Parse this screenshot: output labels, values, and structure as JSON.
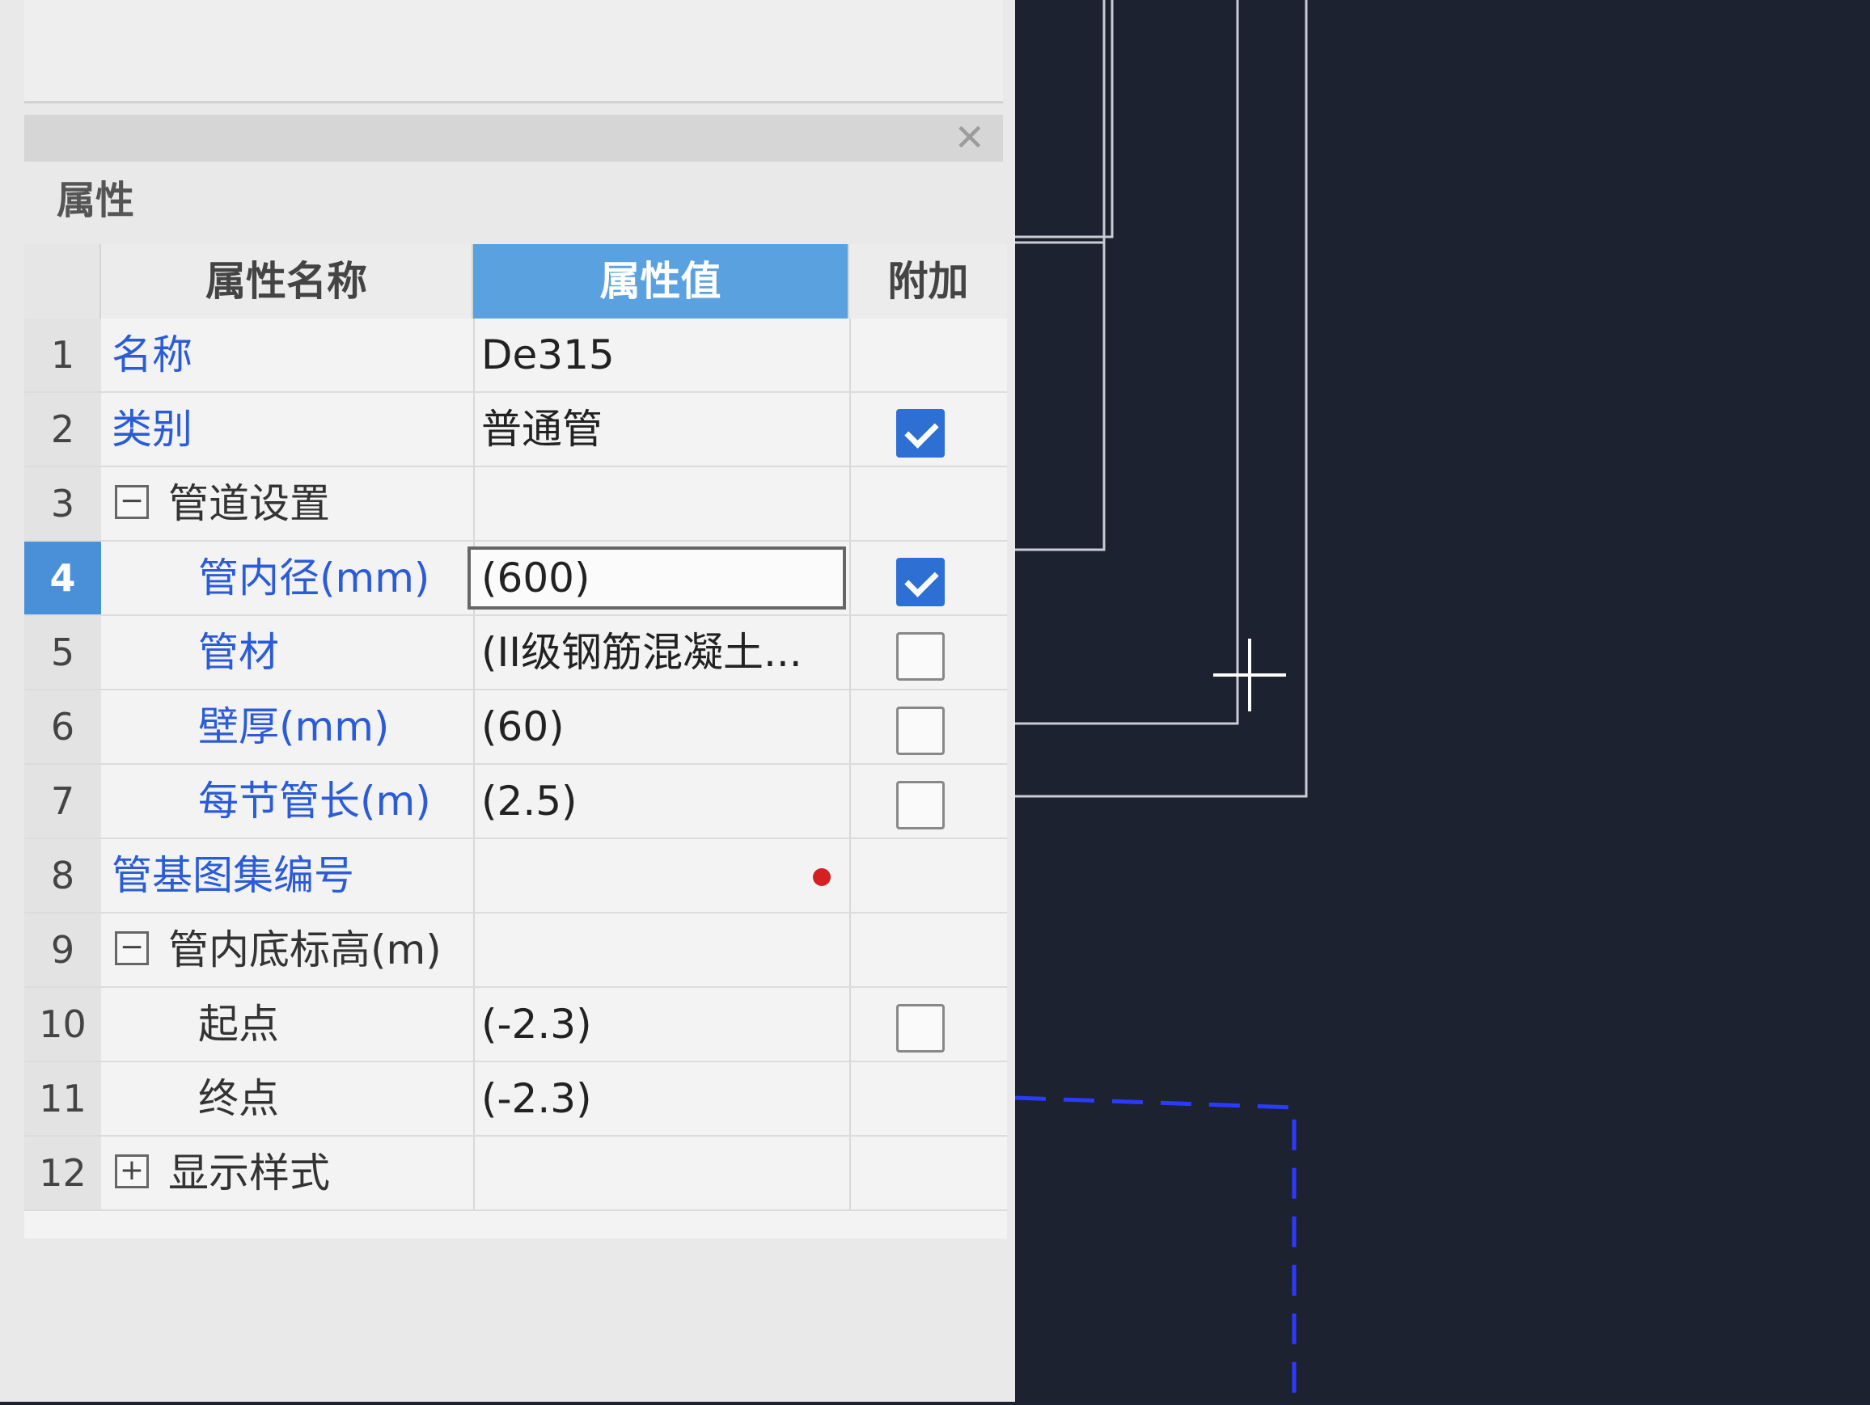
{
  "panel": {
    "title": "属性",
    "headers": {
      "name": "属性名称",
      "value": "属性值",
      "extra": "附加"
    },
    "rows": [
      {
        "idx": "1",
        "name": "名称",
        "value": "De315",
        "check": null,
        "toggle": null,
        "level": 0,
        "color": "blue"
      },
      {
        "idx": "2",
        "name": "类别",
        "value": "普通管",
        "check": true,
        "toggle": null,
        "level": 0,
        "color": "blue"
      },
      {
        "idx": "3",
        "name": "管道设置",
        "value": "",
        "check": null,
        "toggle": "−",
        "level": 0,
        "color": "dark"
      },
      {
        "idx": "4",
        "name": "管内径(mm)",
        "value": "(600)",
        "check": true,
        "toggle": null,
        "level": 1,
        "color": "blue",
        "selected": true
      },
      {
        "idx": "5",
        "name": "管材",
        "value": "(II级钢筋混凝土...",
        "check": false,
        "toggle": null,
        "level": 1,
        "color": "blue"
      },
      {
        "idx": "6",
        "name": "壁厚(mm)",
        "value": "(60)",
        "check": false,
        "toggle": null,
        "level": 1,
        "color": "blue"
      },
      {
        "idx": "7",
        "name": "每节管长(m)",
        "value": "(2.5)",
        "check": false,
        "toggle": null,
        "level": 1,
        "color": "blue"
      },
      {
        "idx": "8",
        "name": "管基图集编号",
        "value": "",
        "check": null,
        "toggle": null,
        "level": 0,
        "color": "blue",
        "required": true
      },
      {
        "idx": "9",
        "name": "管内底标高(m)",
        "value": "",
        "check": null,
        "toggle": "−",
        "level": 0,
        "color": "dark"
      },
      {
        "idx": "10",
        "name": "起点",
        "value": "(-2.3)",
        "check": false,
        "toggle": null,
        "level": 1,
        "color": "dark"
      },
      {
        "idx": "11",
        "name": "终点",
        "value": "(-2.3)",
        "check": null,
        "toggle": null,
        "level": 1,
        "color": "dark"
      },
      {
        "idx": "12",
        "name": "显示样式",
        "value": "",
        "check": null,
        "toggle": "+",
        "level": 0,
        "color": "dark"
      }
    ]
  },
  "icons": {
    "close": "close-icon",
    "crosshair": "crosshair-cursor-icon"
  },
  "colors": {
    "header_accent": "#5aa1df",
    "blue_label": "#2b5bd7",
    "check_on": "#2d6fd3",
    "canvas_bg": "#1d2230",
    "dashed_line": "#2a3bff"
  }
}
